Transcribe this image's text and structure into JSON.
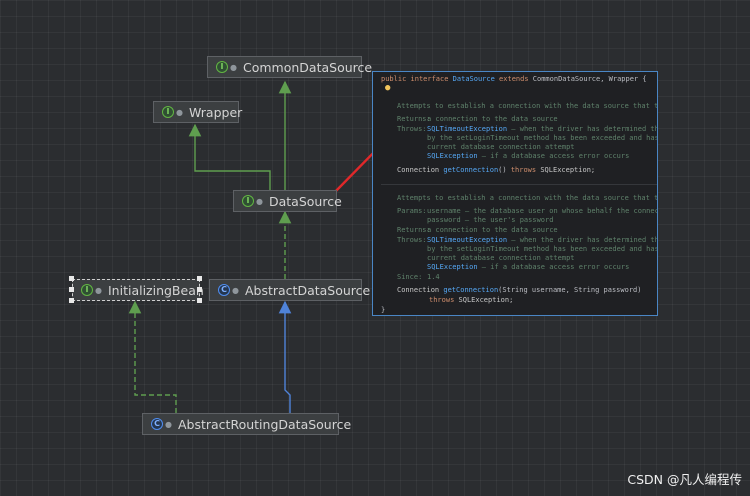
{
  "nodes": {
    "common_data_source": {
      "label": "CommonDataSource",
      "kind": "interface"
    },
    "wrapper": {
      "label": "Wrapper",
      "kind": "interface"
    },
    "data_source": {
      "label": "DataSource",
      "kind": "interface"
    },
    "initializing_bean": {
      "label": "InitializingBean",
      "kind": "interface"
    },
    "abstract_data_source": {
      "label": "AbstractDataSource",
      "kind": "abstract-class"
    },
    "abstract_routing_data_source": {
      "label": "AbstractRoutingDataSource",
      "kind": "abstract-class"
    }
  },
  "badges": {
    "interface": "I",
    "abstract": "C"
  },
  "colors": {
    "extends_edge": "#5f9e4f",
    "implements_edge": "#5f9e4f",
    "class_extends_edge": "#4f83d9",
    "pointer_arrow": "#e0282a",
    "popup_border": "#4a86c5"
  },
  "popup": {
    "header": {
      "kw1": "public",
      "kw2": "interface",
      "name": "DataSource",
      "kw3": "extends",
      "parents": "CommonDataSource, Wrapper {"
    },
    "method1": {
      "desc": "Attempts to establish a connection with the data source that this DataSource object",
      "returns_label": "Returns:",
      "returns_text": "a connection to the data source",
      "throws_label": "Throws:",
      "throws_ex1": "SQLTimeoutException",
      "throws_text1": "– when the driver has determined that the timeout v",
      "throws_text2": "by the setLoginTimeout method has been exceeded and has at least tried",
      "throws_text3": "current database connection attempt",
      "throws_ex2": "SQLException",
      "throws_text4": "– if a database access error occurs",
      "sig_type": "Connection",
      "sig_name": "getConnection",
      "sig_rest": "()",
      "sig_throws": "throws",
      "sig_ex": "SQLException;"
    },
    "method2": {
      "desc": "Attempts to establish a connection with the data source that this DataSource object",
      "params_label": "Params:",
      "param1_name": "username",
      "param1_text": "– the database user on whose behalf the connection is being m",
      "param2_text": "password – the user's password",
      "returns_label": "Returns:",
      "returns_text": "a connection to the data source",
      "throws_label": "Throws:",
      "throws_ex1": "SQLTimeoutException",
      "throws_text1": "– when the driver has determined that the timeout v",
      "throws_text2": "by the setLoginTimeout method has been exceeded and has at least tried",
      "throws_text3": "current database connection attempt",
      "throws_ex2": "SQLException",
      "throws_text4": "– if a database access error occurs",
      "since_label": "Since:",
      "since_text": "1.4",
      "sig_type": "Connection",
      "sig_name": "getConnection",
      "sig_rest": "(String username, String password)",
      "sig_throws": "throws",
      "sig_ex": "SQLException;"
    },
    "closing": "}"
  },
  "watermark": "CSDN @凡人编程传"
}
